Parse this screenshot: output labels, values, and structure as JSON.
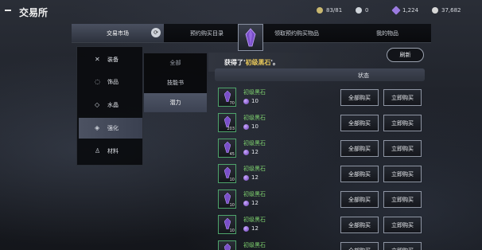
{
  "header": {
    "title": "交易所",
    "resources": [
      {
        "icon": "medal-icon",
        "value": "83/81",
        "color": "#c9b870"
      },
      {
        "icon": "pearl-icon",
        "value": "0",
        "color": "#cfd4da"
      },
      {
        "icon": "crystal-icon",
        "value": "1,224",
        "color": "#9b7be0"
      },
      {
        "icon": "silver-coin-icon",
        "value": "37,682",
        "color": "#d7d7d7"
      }
    ]
  },
  "tabs": [
    {
      "label": "交易市场",
      "active": true,
      "badge": "⟳"
    },
    {
      "label": "预约购买目录",
      "active": false
    },
    {
      "label": "领取预约购买物品",
      "active": false
    },
    {
      "label": "我的物品",
      "active": false
    }
  ],
  "categories": [
    {
      "label": "装备",
      "icon": "crossed-swords-icon",
      "glyph": "✕"
    },
    {
      "label": "饰品",
      "icon": "ring-icon",
      "glyph": "◌"
    },
    {
      "label": "水晶",
      "icon": "crystal-gem-icon",
      "glyph": "◇"
    },
    {
      "label": "强化",
      "icon": "enhance-icon",
      "glyph": "◈",
      "active": true
    },
    {
      "label": "材料",
      "icon": "potion-icon",
      "glyph": "♙"
    }
  ],
  "subcategories": [
    {
      "label": "全部",
      "active": false
    },
    {
      "label": "技能书",
      "active": false
    },
    {
      "label": "潜力",
      "active": true
    }
  ],
  "notice": {
    "prefix": "获得了'",
    "item": "初级黑石",
    "suffix": "'。"
  },
  "refresh_label": "刷新",
  "column_header": {
    "status": "状态"
  },
  "buttons": {
    "buy_all": "全部购买",
    "buy_now": "立即购买"
  },
  "listings": [
    {
      "name": "初级黑石",
      "count": "70",
      "price": "10"
    },
    {
      "name": "初级黑石",
      "count": "203",
      "price": "10"
    },
    {
      "name": "初级黑石",
      "count": "45",
      "price": "12"
    },
    {
      "name": "初级黑石",
      "count": "10",
      "price": "12"
    },
    {
      "name": "初级黑石",
      "count": "10",
      "price": "12"
    },
    {
      "name": "初级黑石",
      "count": "10",
      "price": "12"
    },
    {
      "name": "初级黑石",
      "count": "",
      "price": ""
    }
  ],
  "colors": {
    "item_name": "#7fd36f",
    "highlight": "#e8c85a",
    "gem": "#8c5fd6"
  }
}
